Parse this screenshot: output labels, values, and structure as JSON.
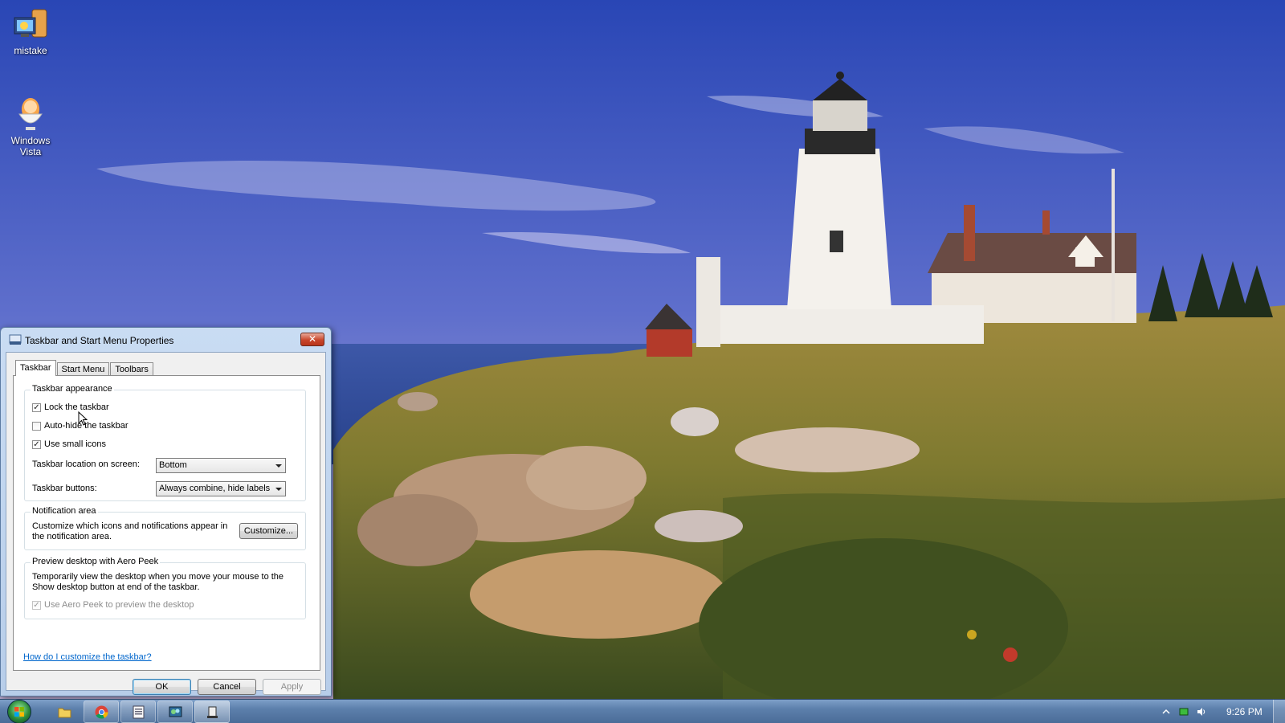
{
  "desktop": {
    "icons": [
      {
        "label": "mistake",
        "icon": "computer-folder-icon"
      },
      {
        "label": "Windows\nVista",
        "icon": "egg-cup-icon"
      }
    ]
  },
  "dialog": {
    "title": "Taskbar and Start Menu Properties",
    "close_label": "✕",
    "tabs": [
      {
        "label": "Taskbar",
        "active": true
      },
      {
        "label": "Start Menu",
        "active": false
      },
      {
        "label": "Toolbars",
        "active": false
      }
    ],
    "appearance": {
      "group_label": "Taskbar appearance",
      "lock": {
        "label": "Lock the taskbar",
        "checked": true
      },
      "autohide": {
        "label": "Auto-hide the taskbar",
        "checked": false
      },
      "small_icons": {
        "label": "Use small icons",
        "checked": true
      },
      "location_label": "Taskbar location on screen:",
      "location_value": "Bottom",
      "buttons_label": "Taskbar buttons:",
      "buttons_value": "Always combine, hide labels"
    },
    "notification": {
      "group_label": "Notification area",
      "description": "Customize which icons and notifications appear in the notification area.",
      "customize_label": "Customize..."
    },
    "aero_peek": {
      "group_label": "Preview desktop with Aero Peek",
      "description": "Temporarily view the desktop when you move your mouse to the Show desktop button at end of the taskbar.",
      "checkbox": {
        "label": "Use Aero Peek to preview the desktop",
        "checked": true,
        "disabled": true
      }
    },
    "help_link": "How do I customize the taskbar?",
    "buttons": {
      "ok": "OK",
      "cancel": "Cancel",
      "apply": "Apply"
    }
  },
  "taskbar": {
    "pinned": [
      "folder-icon",
      "chrome-icon",
      "document-window-icon",
      "network-window-icon",
      "taskbar-properties-icon"
    ],
    "clock": "9:26 PM",
    "tray_icons": [
      "show-hidden-icons-arrow",
      "network-icon",
      "volume-icon"
    ]
  },
  "colors": {
    "sky_top": "#2c4fb8",
    "sky_bottom": "#a8a6d8",
    "link": "#0066cc",
    "taskbar": "#5c7fab"
  }
}
